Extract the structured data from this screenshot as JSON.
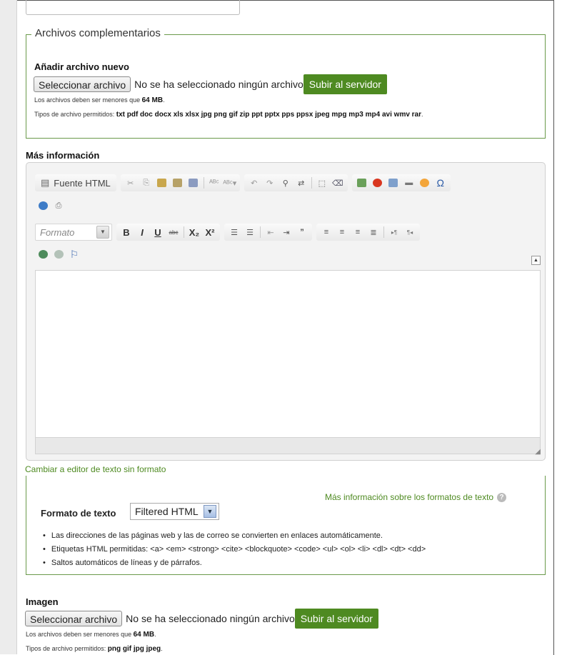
{
  "files_section": {
    "legend": "Archivos complementarios",
    "add_label": "Añadir archivo nuevo",
    "select_button": "Seleccionar archivo",
    "no_file": "No se ha seleccionado ningún archivo",
    "upload_button": "Subir al servidor",
    "size_note_prefix": "Los archivos deben ser menores que",
    "size_note_value": "64 MB",
    "types_prefix": "Tipos de archivo permitidos:",
    "types_value": "txt pdf doc docx xls xlsx jpg png gif zip ppt pptx pps ppsx jpeg mpg mp3 mp4 avi wmv rar"
  },
  "more_info": {
    "label": "Más información",
    "source_button": "Fuente HTML",
    "format_placeholder": "Formato",
    "switch_link": "Cambiar a editor de texto sin formato"
  },
  "text_format": {
    "more_link": "Más información sobre los formatos de texto",
    "label": "Formato de texto",
    "selected": "Filtered HTML",
    "tips": [
      "Las direcciones de las páginas web y las de correo se convierten en enlaces automáticamente.",
      "Etiquetas HTML permitidas: <a> <em> <strong> <cite> <blockquote> <code> <ul> <ol> <li> <dl> <dt> <dd>",
      "Saltos automáticos de líneas y de párrafos."
    ]
  },
  "image_section": {
    "label": "Imagen",
    "select_button": "Seleccionar archivo",
    "no_file": "No se ha seleccionado ningún archivo",
    "upload_button": "Subir al servidor",
    "size_note_prefix": "Los archivos deben ser menores que",
    "size_note_value": "64 MB",
    "types_prefix": "Tipos de archivo permitidos:",
    "types_value": "png gif jpg jpeg"
  }
}
